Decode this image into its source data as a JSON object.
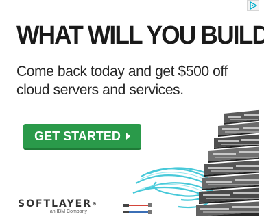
{
  "ad": {
    "headline": "WHAT WILL YOU BUILD?",
    "subtext": "Come back today and get $500 off cloud servers and services.",
    "cta_label": "GET STARTED",
    "cta_icon": "triangle-right-icon",
    "brand": {
      "name": "SOFTLAYER",
      "trademark": "®",
      "tagline": "an IBM Company"
    },
    "adchoices_icon": "adchoices-icon",
    "colors": {
      "accent_green": "#2a9a4a",
      "headline_text": "#1a1a1a",
      "cable_cyan": "#3fc7d8",
      "adchoices_blue": "#00aecd"
    }
  }
}
